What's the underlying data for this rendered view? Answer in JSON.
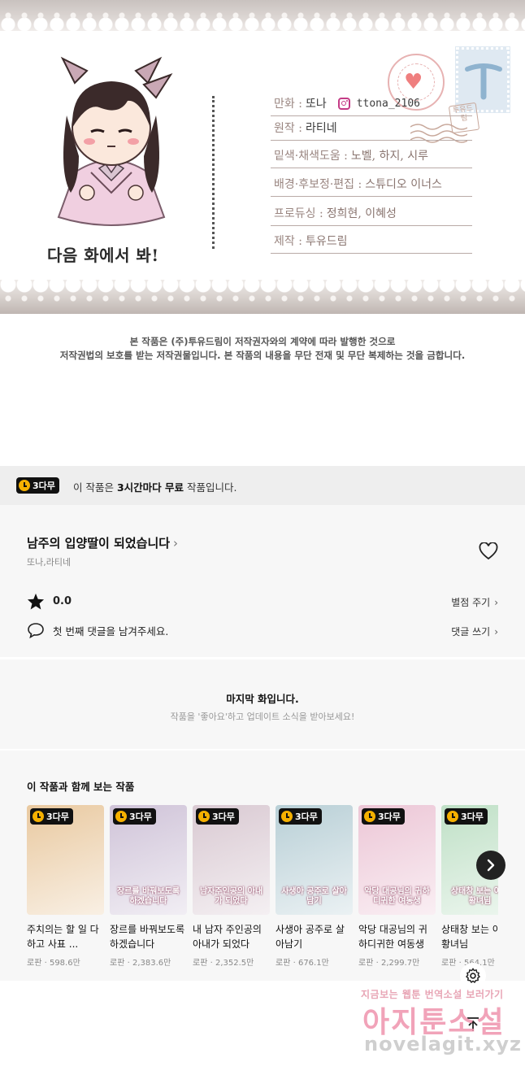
{
  "credits": {
    "closing_line": "다음 화에서 봐!",
    "stamp_text": "투유드림",
    "rows": [
      {
        "label": "만화 : ",
        "value": "또나",
        "instagram": "ttona_2106"
      },
      {
        "label": "원작 : ",
        "value": "라티네"
      },
      {
        "label": "밑색·채색도움 : ",
        "value": "노벨, 하지, 시루"
      },
      {
        "label": "배경·후보정·편집 : ",
        "value": "스튜디오 이너스"
      },
      {
        "label": "프로듀싱 : ",
        "value": "정희현, 이혜성"
      },
      {
        "label": "제작 : ",
        "value": "투유드림"
      }
    ]
  },
  "notice": {
    "line1": "본 작품은 (주)투유드림이 저작권자와의 계약에 따라 발행한 것으로",
    "line2": "저작권법의 보호를 받는 저작권물입니다. 본 작품의 내용을 무단 전재 및 무단 복제하는 것을 금합니다."
  },
  "free_banner": {
    "badge": "3다무",
    "text_prefix": "이 작품은 ",
    "text_bold": "3시간마다 무료",
    "text_suffix": " 작품입니다."
  },
  "work": {
    "title": "남주의 입양딸이 되었습니다",
    "authors": "또나,라티네",
    "rating": "0.0",
    "rate_link": "별점 주기",
    "comment_prompt": "첫 번째 댓글을 남겨주세요.",
    "comment_link": "댓글 쓰기"
  },
  "last_episode": {
    "title": "마지막 화입니다.",
    "subtitle": "작품을 '좋아요'하고 업데이트 소식을 받아보세요!"
  },
  "recommendations": {
    "heading": "이 작품과 함께 보는 작품",
    "badge": "3다무",
    "items": [
      {
        "title": "주치의는 할 일 다 하고 사표 ...",
        "genre": "로판",
        "views": "598.6만",
        "cover_color": "#e9c9a0",
        "cover_text": ""
      },
      {
        "title": "장르를 바꿔보도록 하겠습니다",
        "genre": "로판",
        "views": "2,383.6만",
        "cover_color": "#cfc3d8",
        "cover_text": "장르를 바꿔보도록 하겠습니다"
      },
      {
        "title": "내 남자 주인공의 아내가 되었다",
        "genre": "로판",
        "views": "2,352.5만",
        "cover_color": "#d9c9d2",
        "cover_text": "남자주인공의 아내가 되었다"
      },
      {
        "title": "사생아 공주로 살아남기",
        "genre": "로판",
        "views": "676.1만",
        "cover_color": "#b8cfd6",
        "cover_text": "사생아 공주로 살아남기"
      },
      {
        "title": "악당 대공님의 귀하디귀한 여동생",
        "genre": "로판",
        "views": "2,299.7만",
        "cover_color": "#ecc6d6",
        "cover_text": "악당 대공님의 귀하디귀한 여동생"
      },
      {
        "title": "상태창 보는 아기 황녀님",
        "genre": "로판",
        "views": "564.1만",
        "cover_color": "#bfe0c6",
        "cover_text": "상태창 보는 아기 황녀님"
      }
    ]
  },
  "watermark": {
    "line1": "지금보는 웹툰 번역소설 보러가기",
    "line2": "아지툰소설",
    "line3": "novelagit.xyz"
  },
  "icons": {
    "heart": "heart-outline-icon",
    "star": "star-icon",
    "comment": "speech-bubble-icon",
    "next": "chevron-right-icon",
    "settings": "gear-icon",
    "top": "arrow-up-icon"
  },
  "colors": {
    "badge_yellow": "#f5b000",
    "badge_dark": "#111111",
    "watermark_pink": "#ef93ad"
  }
}
